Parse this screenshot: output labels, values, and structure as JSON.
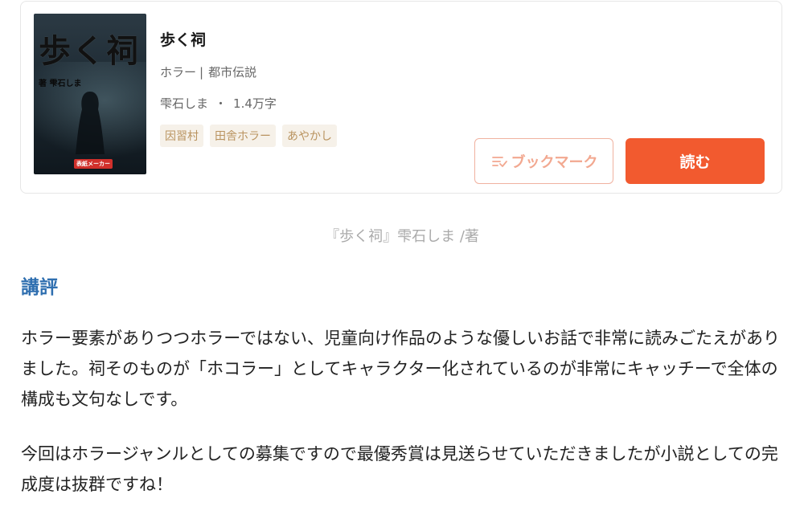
{
  "book": {
    "cover": {
      "title": "歩く祠",
      "author": "著 雫石しま",
      "badge": "表紙メーカー"
    },
    "title": "歩く祠",
    "genre": "ホラー",
    "genre_separator": "|",
    "subgenre": "都市伝説",
    "author": "雫石しま",
    "dot": "・",
    "length": "1.4万字",
    "tags": [
      "因習村",
      "田舎ホラー",
      "あやかし"
    ]
  },
  "actions": {
    "bookmark_label": "ブックマーク",
    "read_label": "読む"
  },
  "caption": "『歩く祠』雫石しま /著",
  "review": {
    "heading": "講評",
    "paragraphs": [
      "ホラー要素がありつつホラーではない、児童向け作品のような優しいお話で非常に読みごたえがありました。祠そのものが「ホコラー」としてキャラクター化されているのが非常にキャッチーで全体の構成も文句なしです。",
      "今回はホラージャンルとしての募集ですので最優秀賞は見送らせていただきましたが小説としての完成度は抜群ですね！"
    ]
  },
  "colors": {
    "accent": "#f25a2f",
    "bookmark_border": "#f0b2a0",
    "tag_text": "#b9935f",
    "tag_bg": "#f6f1e9",
    "heading": "#2f6fb0"
  },
  "icons": {
    "bookmark": "bookmark-list-icon"
  }
}
